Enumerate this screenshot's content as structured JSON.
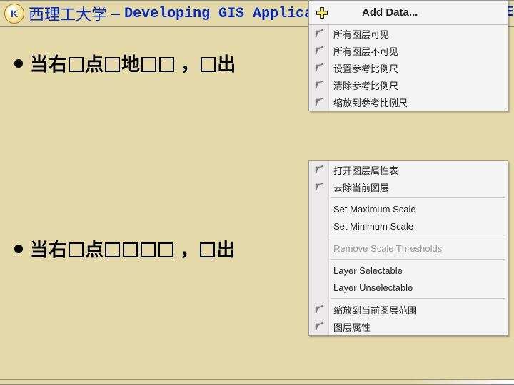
{
  "header": {
    "logo_letter": "K",
    "university": "西理工大学",
    "course": "Developing GIS Application",
    "right_fragment": "C#. NE"
  },
  "bullets": {
    "line1_prefix": "当右",
    "line1_mid1": "点",
    "line1_mid2": "地",
    "line1_suffix": "出",
    "line2_prefix": "当右",
    "line2_mid1": "点",
    "line2_suffix": "出"
  },
  "menu1": {
    "add_data": "Add Data...",
    "items": [
      "所有图层可见",
      "所有图层不可见",
      "设置参考比例尺",
      "清除参考比例尺",
      "缩放到参考比例尺"
    ]
  },
  "menu2": {
    "group1": [
      "打开图层属性表",
      "去除当前图层"
    ],
    "group2": [
      "Set Maximum Scale",
      "Set Minimum Scale"
    ],
    "disabled": "Remove Scale Thresholds",
    "group3": [
      "Layer Selectable",
      "Layer Unselectable"
    ],
    "group4": [
      "缩放到当前图层范围",
      "图层属性"
    ]
  }
}
